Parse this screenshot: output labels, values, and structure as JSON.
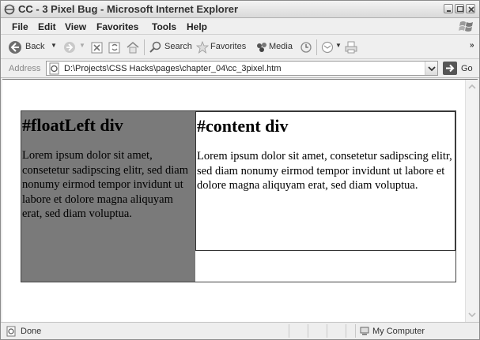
{
  "window": {
    "title": "CC - 3 Pixel Bug - Microsoft Internet Explorer"
  },
  "menu": {
    "items": [
      "File",
      "Edit",
      "View",
      "Favorites",
      "Tools",
      "Help"
    ]
  },
  "toolbar": {
    "back_label": "Back",
    "search_label": "Search",
    "favorites_label": "Favorites",
    "media_label": "Media",
    "more": "»"
  },
  "address": {
    "label": "Address",
    "url": "D:\\Projects\\CSS Hacks\\pages\\chapter_04\\cc_3pixel.htm",
    "go_label": "Go"
  },
  "page": {
    "float_left": {
      "heading": "#floatLeft div",
      "text": "Lorem ipsum dolor sit amet, consetetur sadipscing elitr, sed diam nonumy eirmod tempor invidunt ut labore et dolore magna aliquyam erat, sed diam voluptua."
    },
    "content": {
      "heading": "#content div",
      "text": "Lorem ipsum dolor sit amet, consetetur sadipscing elitr, sed diam nonumy eirmod tempor invidunt ut labore et dolore magna aliquyam erat, sed diam voluptua."
    }
  },
  "status": {
    "text": "Done",
    "zone": "My Computer"
  },
  "colors": {
    "float_left_bg": "#7a7a7a",
    "content_bg": "#ffffff"
  }
}
